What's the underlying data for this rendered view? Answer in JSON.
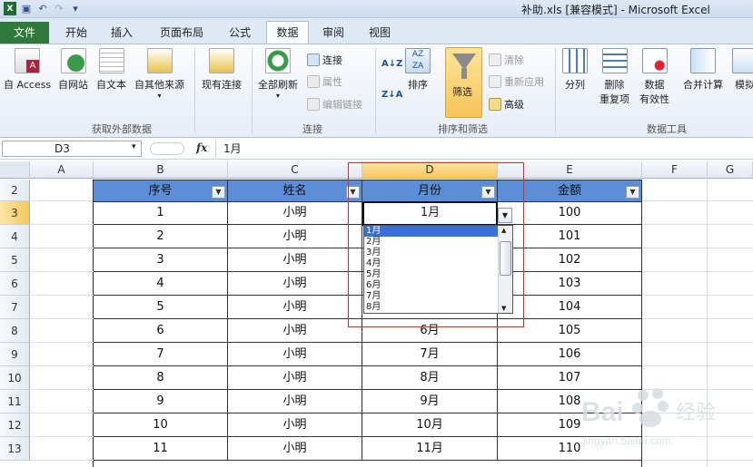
{
  "window": {
    "title": "补助.xls  [兼容模式] - Microsoft Excel"
  },
  "tabs": {
    "file": "文件",
    "home": "开始",
    "insert": "插入",
    "layout": "页面布局",
    "formula": "公式",
    "data": "数据",
    "review": "审阅",
    "view": "视图"
  },
  "ribbon": {
    "g1": {
      "label": "获取外部数据",
      "access": "自 Access",
      "web": "自网站",
      "text": "自文本",
      "other": "自其他来源",
      "existing": "现有连接"
    },
    "g2": {
      "label": "连接",
      "refresh": "全部刷新",
      "connections": "连接",
      "properties": "属性",
      "edit_links": "编辑链接"
    },
    "g3": {
      "label": "排序和筛选",
      "sort": "排序",
      "filter": "筛选",
      "clear": "清除",
      "reapply": "重新应用",
      "advanced": "高级"
    },
    "g4": {
      "label": "数据工具",
      "split": "分列",
      "remove_dup": "删除",
      "remove_dup2": "重复项",
      "validation": "数据",
      "validation2": "有效性",
      "consolidate": "合并计算",
      "whatif": "模拟"
    }
  },
  "formula_bar": {
    "name_box": "D3",
    "fx": "fx",
    "value": "1月"
  },
  "grid": {
    "columns": [
      "A",
      "B",
      "C",
      "D",
      "E",
      "F",
      "G"
    ],
    "rows": [
      "2",
      "3",
      "4",
      "5",
      "6",
      "7",
      "8",
      "9",
      "10",
      "11",
      "12",
      "13"
    ],
    "headers": [
      "序号",
      "姓名",
      "月份",
      "金额"
    ],
    "data": [
      [
        "1",
        "小明",
        "1月",
        "100"
      ],
      [
        "2",
        "小明",
        "",
        "101"
      ],
      [
        "3",
        "小明",
        "",
        "102"
      ],
      [
        "4",
        "小明",
        "",
        "103"
      ],
      [
        "5",
        "小明",
        "5月",
        "104"
      ],
      [
        "6",
        "小明",
        "6月",
        "105"
      ],
      [
        "7",
        "小明",
        "7月",
        "106"
      ],
      [
        "8",
        "小明",
        "8月",
        "107"
      ],
      [
        "9",
        "小明",
        "9月",
        "108"
      ],
      [
        "10",
        "小明",
        "10月",
        "109"
      ],
      [
        "11",
        "小明",
        "11月",
        "110"
      ]
    ]
  },
  "dropdown": {
    "options": [
      "1月",
      "2月",
      "3月",
      "4月",
      "5月",
      "6月",
      "7月",
      "8月"
    ],
    "selected": "1月"
  }
}
